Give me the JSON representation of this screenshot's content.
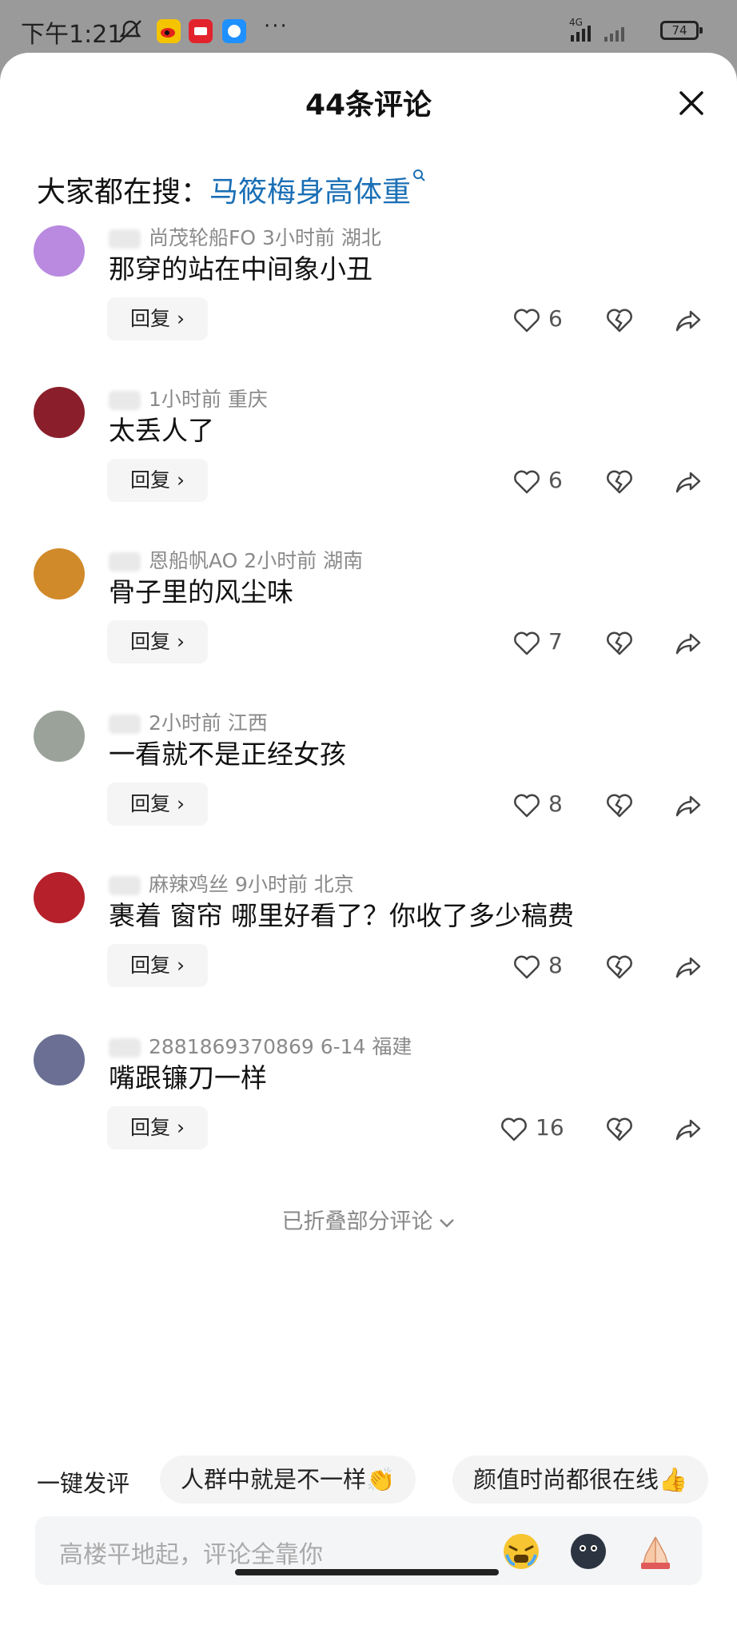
{
  "status_bar": {
    "time": "下午1:21",
    "net_label": "4G",
    "battery": "74",
    "more": "···",
    "icons": [
      "do-not-disturb-icon",
      "weibo-icon",
      "news-app-icon",
      "chat-app-icon",
      "signal-icon",
      "wifi-off-icon",
      "battery-icon"
    ]
  },
  "header": {
    "title": "44条评论"
  },
  "search": {
    "prefix": "大家都在搜：",
    "keyword": "马筱梅身高体重"
  },
  "comments": [
    {
      "meta": "尚茂轮船FO  3小时前  湖北",
      "text": "那穿的站在中间象小丑",
      "reply": "回复 ›",
      "likes": "6",
      "avatar_color": "#b98ae0"
    },
    {
      "meta": "1小时前  重庆",
      "text": "太丢人了",
      "reply": "回复 ›",
      "likes": "6",
      "avatar_color": "#8a1f2b"
    },
    {
      "meta": "恩船帆AO  2小时前  湖南",
      "text": "骨子里的风尘味",
      "reply": "回复 ›",
      "likes": "7",
      "avatar_color": "#d08a2a"
    },
    {
      "meta": "2小时前  江西",
      "text": "一看就不是正经女孩",
      "reply": "回复 ›",
      "likes": "8",
      "avatar_color": "#9aa29a"
    },
    {
      "meta": "麻辣鸡丝  9小时前  北京",
      "text": "裹着 窗帘 哪里好看了？你收了多少稿费",
      "reply": "回复 ›",
      "likes": "8",
      "avatar_color": "#b5202a"
    },
    {
      "meta": "2881869370869  6-14  福建",
      "text": "嘴跟镰刀一样",
      "reply": "回复 ›",
      "likes": "16",
      "avatar_color": "#6a6f93"
    }
  ],
  "folded": {
    "label": "已折叠部分评论"
  },
  "quick_comments": {
    "label": "一键发评",
    "chips": [
      "人群中就是不一样👏",
      "颜值时尚都很在线👍"
    ]
  },
  "composer": {
    "placeholder": "高楼平地起，评论全靠你",
    "emojis": [
      "crying-emoji",
      "dark-face-emoji",
      "pray-hands-emoji"
    ]
  }
}
